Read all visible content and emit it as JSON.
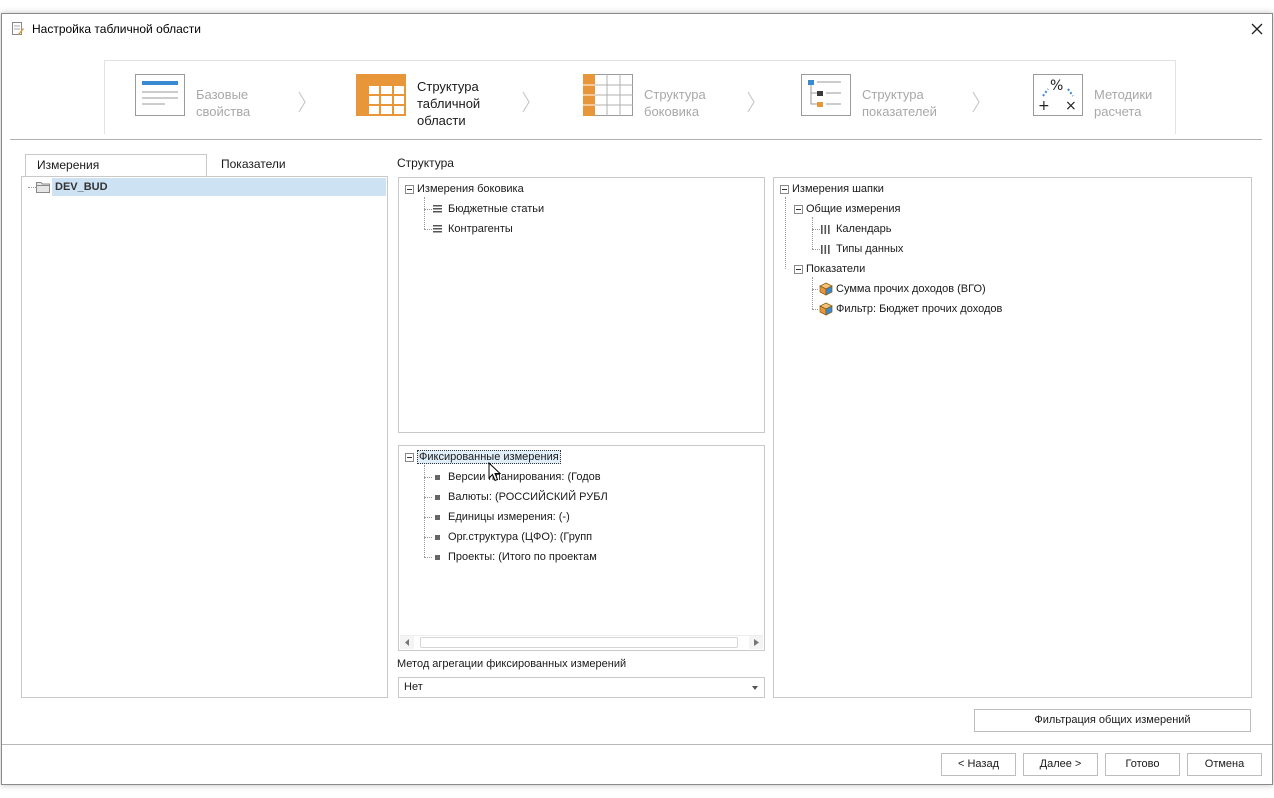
{
  "window": {
    "title": "Настройка табличной области"
  },
  "steps": [
    {
      "label": "Базовые\nсвойства"
    },
    {
      "label": "Структура\nтабличной\nобласти"
    },
    {
      "label": "Структура\nбоковика"
    },
    {
      "label": "Структура\nпоказателей"
    },
    {
      "label": "Методики\nрасчета"
    }
  ],
  "left": {
    "tabs": [
      "Измерения",
      "Показатели"
    ],
    "tree_root": "DEV_BUD"
  },
  "structure": {
    "title": "Структура",
    "side": {
      "root": "Измерения боковика",
      "items": [
        "Бюджетные статьи",
        "Контрагенты"
      ]
    },
    "fixed": {
      "root": "Фиксированные измерения",
      "items": [
        "Версии планирования: (Годов",
        "Валюты: (РОССИЙСКИЙ РУБЛ",
        "Единицы измерения: (-)",
        "Орг.структура (ЦФО): (Групп",
        "Проекты: (Итого по проектам"
      ]
    },
    "aggregation": {
      "label": "Метод агрегации фиксированных измерений",
      "value": "Нет"
    }
  },
  "header": {
    "root": "Измерения шапки",
    "common": {
      "label": "Общие измерения",
      "items": [
        "Календарь",
        "Типы данных"
      ]
    },
    "indicators": {
      "label": "Показатели",
      "items": [
        "Сумма прочих доходов (ВГО)",
        "Фильтр: Бюджет прочих доходов"
      ]
    }
  },
  "buttons": {
    "filter": "Фильтрация общих измерений",
    "back": "< Назад",
    "next": "Далее >",
    "done": "Готово",
    "cancel": "Отмена"
  },
  "colors": {
    "accent": "#e8963a",
    "blue": "#3a8ad1",
    "selection": "#cde3f4"
  }
}
